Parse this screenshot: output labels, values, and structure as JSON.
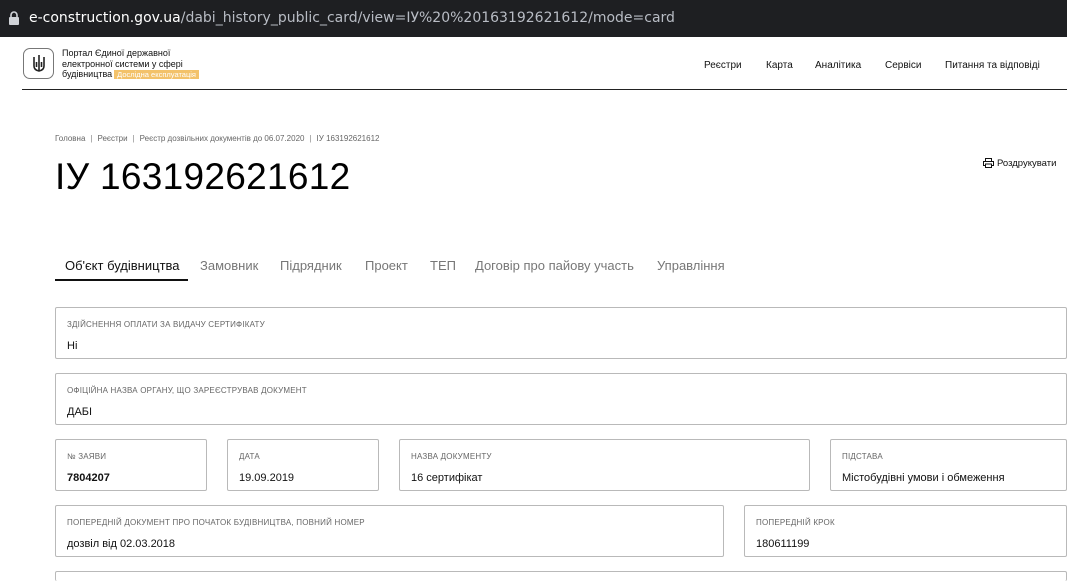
{
  "browser": {
    "url_domain": "e-construction.gov.ua",
    "url_path": "/dabi_history_public_card/view=ІУ%20%20163192621612/mode=card"
  },
  "header": {
    "portal_line1": "Портал Єдиної державної",
    "portal_line2": "електронної системи у сфері",
    "portal_line3": "будівництва",
    "badge": "Дослідна експлуатація",
    "nav": [
      "Реєстри",
      "Карта",
      "Аналітика",
      "Сервіси",
      "Питання та відповіді"
    ]
  },
  "breadcrumb": [
    "Головна",
    "Реєстри",
    "Реєстр дозвільних документів до 06.07.2020",
    "ІУ 163192621612"
  ],
  "page": {
    "title": "ІУ 163192621612",
    "print_label": "Роздрукувати"
  },
  "tabs": [
    "Об'єкт будівництва",
    "Замовник",
    "Підрядник",
    "Проект",
    "ТЕП",
    "Договір про пайову участь",
    "Управління"
  ],
  "fields": {
    "payment": {
      "label": "ЗДІЙСНЕННЯ ОПЛАТИ ЗА ВИДАЧУ СЕРТИФІКАТУ",
      "value": "Ні"
    },
    "authority": {
      "label": "ОФІЦІЙНА НАЗВА ОРГАНУ, ЩО ЗАРЕЄСТРУВАВ ДОКУМЕНТ",
      "value": "ДАБІ"
    },
    "application_no": {
      "label": "№ ЗАЯВИ",
      "value": "7804207"
    },
    "date": {
      "label": "ДАТА",
      "value": "19.09.2019"
    },
    "doc_name": {
      "label": "НАЗВА ДОКУМЕНТУ",
      "value": "16 сертифікат"
    },
    "basis": {
      "label": "ПІДСТАВА",
      "value": "Містобудівні умови і обмеження"
    },
    "prev_doc": {
      "label": "ПОПЕРЕДНІЙ ДОКУМЕНТ ПРО ПОЧАТОК БУДІВНИЦТВА, ПОВНИЙ НОМЕР",
      "value": "дозвіл від 02.03.2018"
    },
    "prev_step": {
      "label": "ПОПЕРЕДНІЙ КРОК",
      "value": "180611199"
    }
  }
}
